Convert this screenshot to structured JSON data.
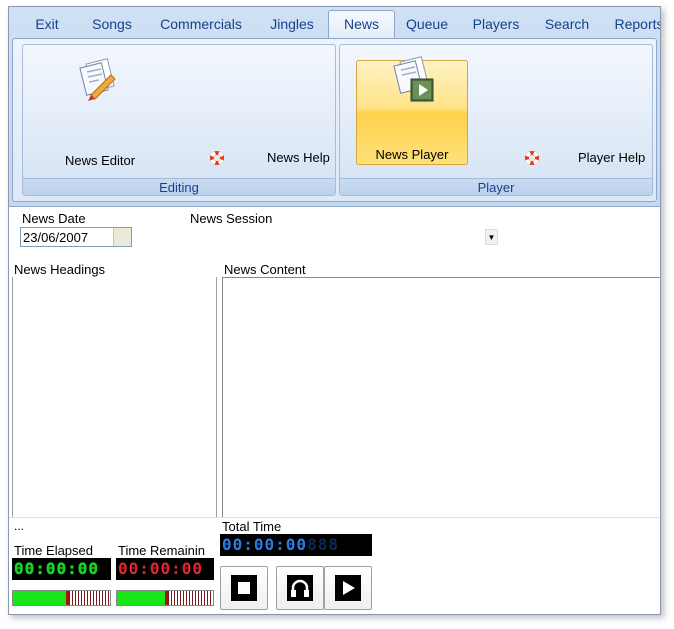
{
  "tabs": [
    "Exit",
    "Songs",
    "Commercials",
    "Jingles",
    "News",
    "Queue",
    "Players",
    "Search",
    "Reports"
  ],
  "active_tab": "News",
  "ribbon": {
    "editing": {
      "label": "Editing",
      "news_editor": "News Editor",
      "news_help": "News Help"
    },
    "player": {
      "label": "Player",
      "news_player": "News Player",
      "player_help": "Player Help"
    }
  },
  "form": {
    "news_date_label": "News Date",
    "news_date_value": "23/06/2007",
    "news_session_label": "News Session",
    "news_headings_label": "News Headings",
    "news_content_label": "News Content"
  },
  "player_panel": {
    "status_text": "...",
    "time_elapsed_label": "Time Elapsed",
    "time_elapsed_value": "00:00:00",
    "time_remaining_label": "Time Remainin",
    "time_remaining_value": "00:00:00",
    "total_time_label": "Total Time",
    "total_time_value": "00:00:00",
    "total_time_ghost": "888",
    "elapsed_meter_level": 0.55,
    "remaining_meter_level": 0.5
  },
  "colors": {
    "ribbon_text": "#15428b",
    "selected_button": "#ffd24d",
    "lcd_green": "#1fd12a",
    "lcd_red": "#e0282e",
    "lcd_blue": "#2a7be6",
    "meter_fill": "#19e619"
  },
  "icons": {
    "news_editor": "document-pencil-icon",
    "help": "lifebuoy-icon",
    "news_player": "document-play-icon",
    "stop": "stop-icon",
    "preview": "headphones-icon",
    "play": "play-icon"
  }
}
